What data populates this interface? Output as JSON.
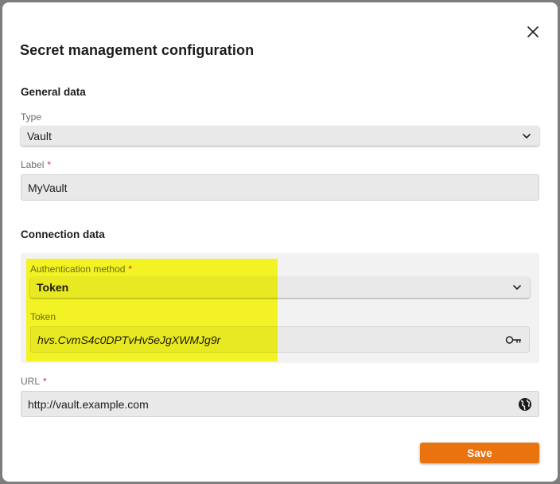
{
  "dialog": {
    "title": "Secret management configuration",
    "close_icon": "close-icon"
  },
  "general": {
    "section_title": "General data",
    "type": {
      "label": "Type",
      "value": "Vault"
    },
    "label_field": {
      "label": "Label",
      "required_mark": "*",
      "value": "MyVault"
    }
  },
  "connection": {
    "section_title": "Connection data",
    "auth_method": {
      "label": "Authentication method",
      "required_mark": "*",
      "value": "Token"
    },
    "token": {
      "label": "Token",
      "value": "hvs.CvmS4c0DPTvHv5eJgXWMJg9r",
      "icon": "key-icon"
    },
    "url": {
      "label": "URL",
      "required_mark": "*",
      "value": "http://vault.example.com",
      "icon": "globe-icon"
    }
  },
  "footer": {
    "save_label": "Save"
  },
  "colors": {
    "accent": "#e8730f",
    "highlight": "#ffff00",
    "required": "#d0323a"
  }
}
